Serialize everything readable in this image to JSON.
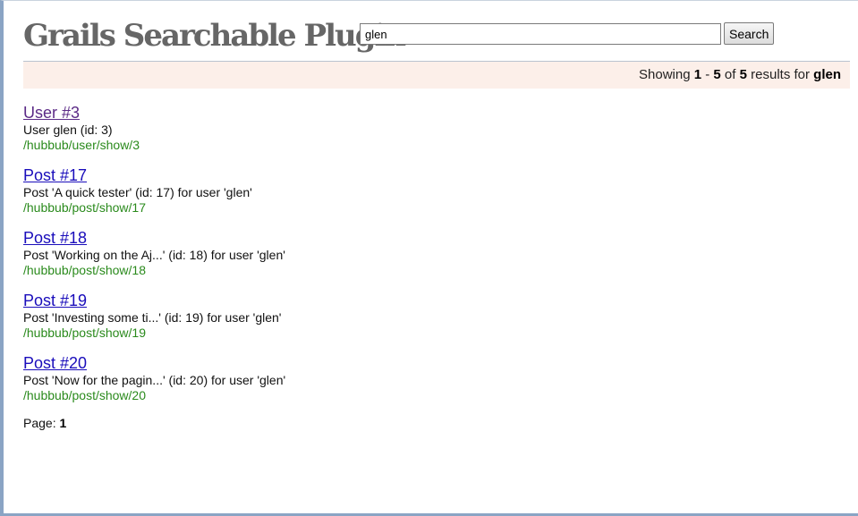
{
  "header": {
    "logo": "Grails Searchable Plugin",
    "search_value": "glen",
    "search_button": "Search"
  },
  "summary": {
    "prefix": "Showing ",
    "start": "1",
    "dash": " - ",
    "end": "5",
    "of": " of ",
    "total": "5",
    "results_for": " results for ",
    "query": "glen"
  },
  "results": [
    {
      "title": "User #3",
      "desc": "User glen (id: 3)",
      "url": "/hubbub/user/show/3"
    },
    {
      "title": "Post #17",
      "desc": "Post 'A quick tester' (id: 17) for user 'glen'",
      "url": "/hubbub/post/show/17"
    },
    {
      "title": "Post #18",
      "desc": "Post 'Working on the Aj...' (id: 18) for user 'glen'",
      "url": "/hubbub/post/show/18"
    },
    {
      "title": "Post #19",
      "desc": "Post 'Investing some ti...' (id: 19) for user 'glen'",
      "url": "/hubbub/post/show/19"
    },
    {
      "title": "Post #20",
      "desc": "Post 'Now for the pagin...' (id: 20) for user 'glen'",
      "url": "/hubbub/post/show/20"
    }
  ],
  "pager": {
    "label": "Page: ",
    "current": "1"
  },
  "colors": {
    "link": "#1a0dbb",
    "visited_link": "#5b2a86",
    "url": "#2a8a1c",
    "summary_bg": "#fcefe9"
  }
}
